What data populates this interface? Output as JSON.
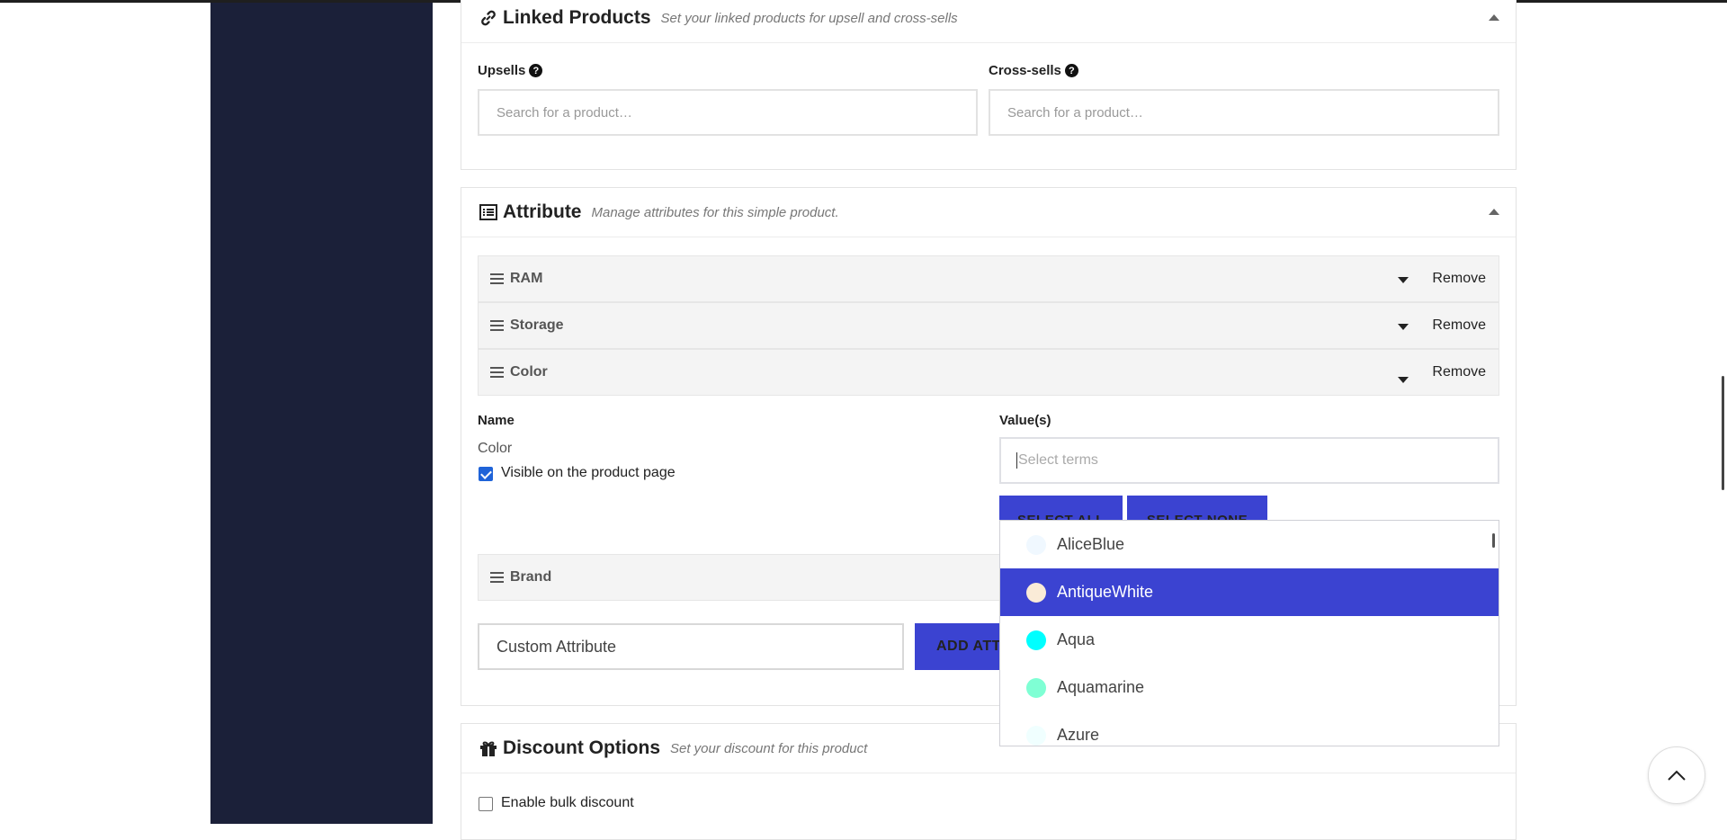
{
  "linked_products": {
    "title": "Linked Products",
    "subtitle": "Set your linked products for upsell and cross-sells",
    "upsells_label": "Upsells",
    "upsells_placeholder": "Search for a product…",
    "crosssells_label": "Cross-sells",
    "crosssells_placeholder": "Search for a product…"
  },
  "attribute": {
    "title": "Attribute",
    "subtitle": "Manage attributes for this simple product.",
    "rows": [
      {
        "name": "RAM",
        "remove": "Remove"
      },
      {
        "name": "Storage",
        "remove": "Remove"
      },
      {
        "name": "Color",
        "remove": "Remove"
      },
      {
        "name": "Brand"
      }
    ],
    "name_label": "Name",
    "name_value": "Color",
    "visible_label": "Visible on the product page",
    "visible_checked": true,
    "values_label": "Value(s)",
    "terms_placeholder": "Select terms",
    "select_all": "SELECT ALL",
    "select_none": "SELECT NONE",
    "custom_attribute_value": "Custom Attribute",
    "add_attribute": "ADD ATTRIBUTE"
  },
  "color_options": [
    {
      "label": "AliceBlue",
      "swatch": "#F0F8FF"
    },
    {
      "label": "AntiqueWhite",
      "swatch": "#FAEBD7",
      "highlighted": true
    },
    {
      "label": "Aqua",
      "swatch": "#00FFFF"
    },
    {
      "label": "Aquamarine",
      "swatch": "#7FFFD4"
    },
    {
      "label": "Azure",
      "swatch": "#F0FFFF"
    }
  ],
  "discount": {
    "title": "Discount Options",
    "subtitle": "Set your discount for this product",
    "bulk_label": "Enable bulk discount",
    "bulk_checked": false
  },
  "colors": {
    "sidebar": "#1B2039",
    "accent": "#3B43D1",
    "checkbox": "#1F63D8"
  },
  "icons": {
    "linked": "link-icon",
    "attribute": "list-icon",
    "discount": "gift-icon",
    "help": "question-circle-icon",
    "drag": "drag-handle-icon",
    "back_to_top": "chevron-up-icon"
  }
}
